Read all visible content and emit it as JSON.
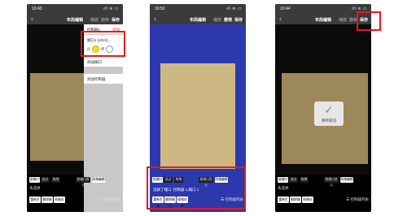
{
  "phones": [
    {
      "status": {
        "time": "10:43",
        "signal": "ıll ≋ ▭"
      },
      "nav": {
        "back": "‹",
        "title": "布局编辑",
        "actions": [
          "缩放",
          "旋转",
          "保存"
        ]
      },
      "dropdown": {
        "controller_label": "控制器1",
        "controller_add": "添加",
        "port_label": "端口1 (1024)",
        "port_option_a": "点",
        "port_option_b": "线",
        "add_port": "添加端口",
        "add_controller": "添加控制器"
      },
      "segments": [
        "选端口",
        "选点",
        "拖拽",
        "按端口显示",
        "网格编辑"
      ],
      "state_text": "未选择",
      "buttons": [
        "重新生成",
        "删除端口",
        "网格对齐"
      ],
      "list_link": "控制器列表"
    },
    {
      "status": {
        "time": "10:52",
        "signal": "ıll ≋ ▭"
      },
      "nav": {
        "back": "‹",
        "title": "布局编辑",
        "actions": [
          "缩放",
          "撤销",
          "保存"
        ]
      },
      "segments": [
        "选端口",
        "选点",
        "拖拽",
        "按端口显示",
        "网格编辑"
      ],
      "state_text": "选择了端口: 控制器 1,端口 1",
      "buttons": [
        "重新生成",
        "删除端口",
        "网格对齐"
      ],
      "list_link": "控制器列表"
    },
    {
      "status": {
        "time": "10:44",
        "signal": "ıll ≋ ▭"
      },
      "nav": {
        "back": "‹",
        "title": "布局编辑",
        "actions": [
          "缩放",
          "旋转",
          "保存"
        ]
      },
      "toast": {
        "icon": "✓",
        "message": "保存成功"
      },
      "segments": [
        "选端口",
        "选点",
        "拖拽",
        "按端口显示",
        "网格编辑"
      ],
      "state_text": "未选择",
      "buttons": [
        "重新生成",
        "删除端口",
        "网格对齐"
      ],
      "list_link": "控制器列表"
    }
  ],
  "colors": {
    "highlight": "#e3191e",
    "selected_port_bg": "#16208a",
    "led_panel": "#d8c48f"
  }
}
